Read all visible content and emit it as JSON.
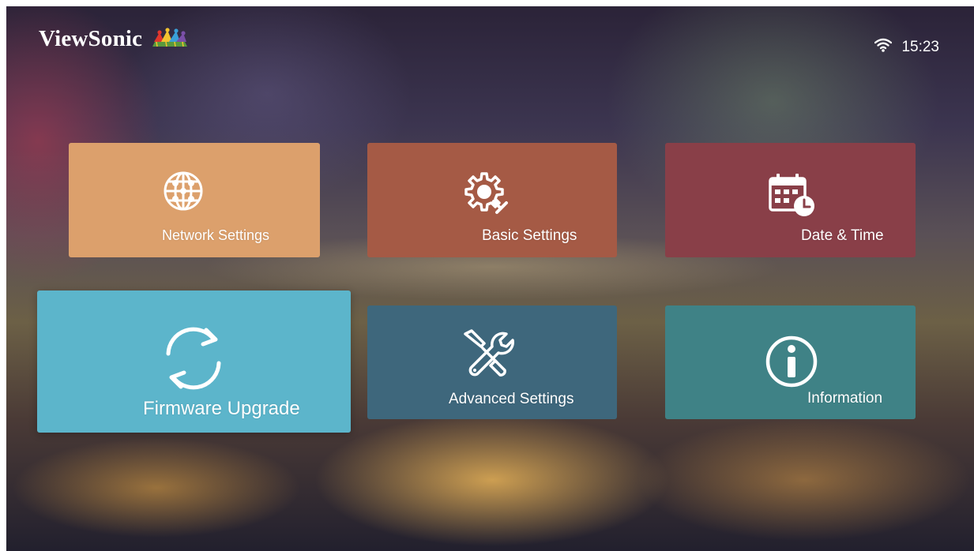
{
  "brand": {
    "logo_text": "ViewSonic",
    "logo_icon": "viewsonic-birds-logo"
  },
  "status_bar": {
    "wifi_icon": "wifi-icon",
    "time": "15:23"
  },
  "menu": {
    "tiles": [
      {
        "label": "Network Settings",
        "icon": "globe-icon",
        "color": "#dca06c",
        "selected": false
      },
      {
        "label": "Basic Settings",
        "icon": "gear-icon",
        "color": "#a55a45",
        "selected": false
      },
      {
        "label": "Date & Time",
        "icon": "calendar-clock-icon",
        "color": "#893f48",
        "selected": false
      },
      {
        "label": "Firmware Upgrade",
        "icon": "refresh-icon",
        "color": "#5cb5cb",
        "selected": true
      },
      {
        "label": "Advanced Settings",
        "icon": "wrench-screwdriver-icon",
        "color": "#3e677c",
        "selected": false
      },
      {
        "label": "Information",
        "icon": "info-icon",
        "color": "#3f8286",
        "selected": false
      }
    ]
  }
}
